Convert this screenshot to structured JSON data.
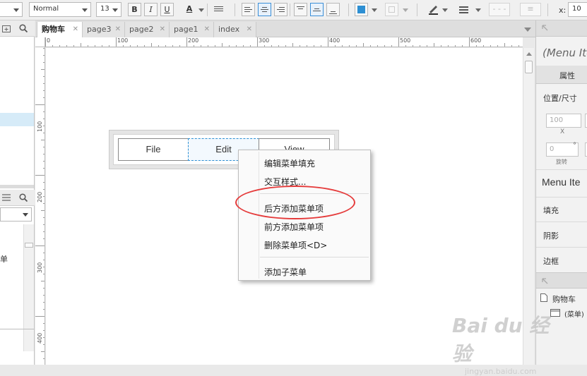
{
  "toolbar": {
    "font_style": "Normal",
    "font_size": "13",
    "bold": "B",
    "italic": "I",
    "underline": "U",
    "text_color_glyph": "A",
    "x_label": "x:",
    "x_value": "10",
    "accent_color": "#2d8fd3"
  },
  "tabs": [
    {
      "label": "购物车",
      "active": true
    },
    {
      "label": "page3"
    },
    {
      "label": "page2"
    },
    {
      "label": "page1"
    },
    {
      "label": "index"
    }
  ],
  "tab_close_glyph": "✕",
  "ruler": {
    "h_labels": [
      "0",
      "100",
      "200",
      "300",
      "400",
      "500",
      "600"
    ],
    "v_labels": [
      "100",
      "200",
      "300",
      "400"
    ]
  },
  "left_panel": {
    "fragment_label": "单"
  },
  "menu_widget": {
    "items": [
      "File",
      "Edit",
      "View"
    ]
  },
  "context_menu": {
    "items": [
      "编辑菜单填充",
      "交互样式...",
      "后方添加菜单项",
      "前方添加菜单项",
      "删除菜单项<D>",
      "添加子菜单"
    ],
    "highlighted_index": 2,
    "highlight_color": "#e53b3b"
  },
  "right_panel": {
    "title": "(Menu Ite",
    "tab_label": "属性",
    "position_size_label": "位置/尺寸",
    "x_value": "100",
    "x_caption": "X",
    "rotation_value": "0",
    "rotation_unit": "°",
    "rotation_caption": "旋转",
    "item_name": "Menu Ite",
    "fill_label": "填充",
    "shadow_label": "阴影",
    "border_label": "边框",
    "outline_page": "购物车",
    "outline_child": "(菜单)"
  },
  "watermark": {
    "logo": "Bai du 经验",
    "url": "jingyan.baidu.com"
  }
}
